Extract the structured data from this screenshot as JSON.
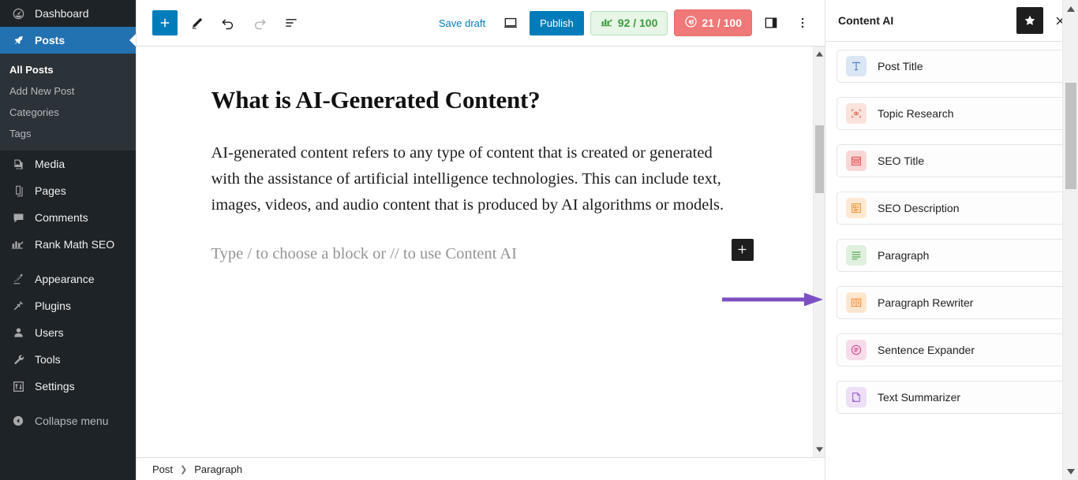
{
  "accent": {
    "wp_blue": "#2271b1",
    "editor_blue": "#007cba",
    "seo_green": "#3e9c3e",
    "contentai_red": "#ef7878",
    "annotation_purple": "#7e4fc4",
    "admin_dark": "#1d2327",
    "submenu_dark": "#2c3338"
  },
  "admin_sidebar": {
    "items": [
      {
        "label": "Dashboard",
        "icon": "dashboard-icon",
        "current": false,
        "dim": false
      },
      {
        "label": "Posts",
        "icon": "pin-icon",
        "current": true,
        "dim": false
      },
      {
        "label": "Media",
        "icon": "media-icon",
        "current": false,
        "dim": false
      },
      {
        "label": "Pages",
        "icon": "pages-icon",
        "current": false,
        "dim": false
      },
      {
        "label": "Comments",
        "icon": "comments-icon",
        "current": false,
        "dim": false
      },
      {
        "label": "Rank Math SEO",
        "icon": "rankmath-icon",
        "current": false,
        "dim": false
      },
      {
        "label": "Appearance",
        "icon": "appearance-brush-icon",
        "current": false,
        "dim": false
      },
      {
        "label": "Plugins",
        "icon": "plugins-plug-icon",
        "current": false,
        "dim": false
      },
      {
        "label": "Users",
        "icon": "users-icon",
        "current": false,
        "dim": false
      },
      {
        "label": "Tools",
        "icon": "tools-wrench-icon",
        "current": false,
        "dim": false
      },
      {
        "label": "Settings",
        "icon": "settings-sliders-icon",
        "current": false,
        "dim": false
      },
      {
        "label": "Collapse menu",
        "icon": "collapse-arrow-icon",
        "current": false,
        "dim": true
      }
    ],
    "posts_submenu": [
      {
        "label": "All Posts",
        "current": true
      },
      {
        "label": "Add New Post",
        "current": false
      },
      {
        "label": "Categories",
        "current": false
      },
      {
        "label": "Tags",
        "current": false
      }
    ]
  },
  "editor_header": {
    "add_block_label": "+",
    "tools": [
      {
        "name": "block-inserter",
        "icon": "plus-icon",
        "state": "primary"
      },
      {
        "name": "edit-tool",
        "icon": "pencil-icon",
        "state": "normal"
      },
      {
        "name": "undo",
        "icon": "undo-arrow-icon",
        "state": "normal"
      },
      {
        "name": "redo",
        "icon": "redo-arrow-icon",
        "state": "disabled"
      },
      {
        "name": "document-overview",
        "icon": "list-view-icon",
        "state": "normal"
      }
    ],
    "save_draft_label": "Save draft",
    "preview_icon": "desktop-preview-icon",
    "publish_label": "Publish",
    "seo_score": {
      "label": "92 / 100",
      "icon": "rankmath-bars-icon",
      "value": 92,
      "max": 100
    },
    "content_ai_score": {
      "label": "21 / 100",
      "icon": "content-ai-circle-icon",
      "value": 21,
      "max": 100
    },
    "settings_icon": "sidebar-toggle-icon",
    "options_icon": "three-dots-vertical-icon"
  },
  "post": {
    "heading": "What is AI-Generated Content?",
    "paragraph": "AI-generated content refers to any type of content that is created or generated with the assistance of artificial intelligence technologies. This can include text, images, videos, and audio content that is produced by AI algorithms or models.",
    "empty_block_placeholder": "Type / to choose a block or // to use Content AI"
  },
  "breadcrumb": {
    "items": [
      "Post",
      "Paragraph"
    ],
    "separator": "❯"
  },
  "content_ai": {
    "title": "Content AI",
    "star_icon": "star-icon",
    "close_icon": "close-icon",
    "tools": [
      {
        "label": "Post Title",
        "icon": "post-title-icon",
        "fg": "#3f6fb5",
        "bg": "#dbe6f5",
        "highlighted": false
      },
      {
        "label": "Topic Research",
        "icon": "topic-research-eye-icon",
        "fg": "#e0715c",
        "bg": "#fbe2dc",
        "highlighted": false
      },
      {
        "label": "SEO Title",
        "icon": "seo-title-card-icon",
        "fg": "#e04a4a",
        "bg": "#f9d7d7",
        "highlighted": false
      },
      {
        "label": "SEO Description",
        "icon": "seo-description-icon",
        "fg": "#ef9430",
        "bg": "#fde9d3",
        "highlighted": false
      },
      {
        "label": "Paragraph",
        "icon": "paragraph-lines-icon",
        "fg": "#5aa85a",
        "bg": "#dff0de",
        "highlighted": true
      },
      {
        "label": "Paragraph Rewriter",
        "icon": "paragraph-rewriter-book-icon",
        "fg": "#ef8f3c",
        "bg": "#fde6d0",
        "highlighted": false
      },
      {
        "label": "Sentence Expander",
        "icon": "sentence-expander-icon",
        "fg": "#d4478e",
        "bg": "#f8dcea",
        "highlighted": false
      },
      {
        "label": "Text Summarizer",
        "icon": "text-summarizer-icon",
        "fg": "#9a63c8",
        "bg": "#ecdff6",
        "highlighted": false
      }
    ]
  },
  "annotation": {
    "type": "arrow",
    "points_to": "Paragraph",
    "color": "#7e4fc4"
  }
}
